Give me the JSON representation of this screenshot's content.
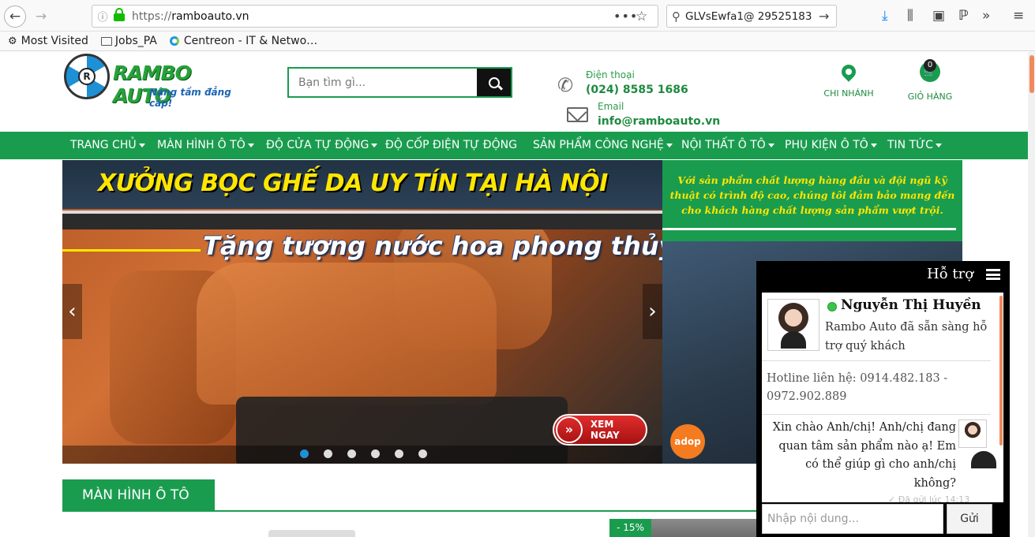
{
  "browser": {
    "url_prefix": "https://",
    "url_domain": "ramboauto.vn",
    "search_query": "GLVsEwfa1@ 29525183",
    "bookmarks": [
      "Most Visited",
      "Jobs_PA",
      "Centreon - IT & Netwo…"
    ]
  },
  "header": {
    "logo_text": "RAMBO AUTO",
    "logo_hub": "R",
    "slogan": "Nâng tầm đẳng cấp!",
    "search_placeholder": "Bạn tìm gì...",
    "phone_label": "Điện thoại",
    "phone_value": "(024) 8585 1686",
    "email_label": "Email",
    "email_value": "info@ramboauto.vn",
    "branch_label": "CHI NHÁNH",
    "cart_label": "GIỎ HÀNG",
    "cart_count": "0"
  },
  "menu": {
    "items": [
      {
        "label": "TRANG CHỦ",
        "dropdown": true
      },
      {
        "label": "MÀN HÌNH Ô TÔ",
        "dropdown": true
      },
      {
        "label": "ĐỘ CỬA TỰ ĐỘNG",
        "dropdown": true
      },
      {
        "label": "ĐỘ CỐP ĐIỆN TỰ ĐỘNG",
        "dropdown": false
      },
      {
        "label": "SẢN PHẨM CÔNG NGHỆ",
        "dropdown": true
      },
      {
        "label": "NỘI THẤT Ô TÔ",
        "dropdown": true
      },
      {
        "label": "PHỤ KIỆN Ô TÔ",
        "dropdown": true
      },
      {
        "label": "TIN TỨC",
        "dropdown": true
      }
    ]
  },
  "hero": {
    "title": "XƯỞNG BỌC GHẾ DA UY TÍN TẠI HÀ NỘI",
    "subtitle": "Tặng tượng nước hoa phong thủy",
    "cta": "XEM NGAY",
    "prev": "‹",
    "next": "›",
    "slide_count": 6,
    "active_slide": 1
  },
  "side_banner": {
    "text": "Với sản phẩm chất lượng hàng đầu và đội ngũ kỹ thuật có trình độ cao, chúng tôi đảm bảo mang đến cho khách hàng chất lượng sản phẩm vượt trội.",
    "badge": "adop"
  },
  "section": {
    "title": "MÀN HÌNH Ô TÔ",
    "discount": "- 15%"
  },
  "chat": {
    "header": "Hỗ trợ",
    "agent_name": "Nguyễn Thị Huyền",
    "agent_msg": "Rambo Auto đã sẵn sàng hỗ trợ quý khách",
    "hotline": "Hotline liên hệ: 0914.482.183 - 0972.902.889",
    "message": "Xin chào Anh/chị! Anh/chị đang quan tâm sản phẩm nào ạ! Em có thể giúp gì cho anh/chị không?",
    "sent_time": "✓ Đã gửi lúc 14:13",
    "input_placeholder": "Nhập nội dung...",
    "send": "Gửi"
  }
}
